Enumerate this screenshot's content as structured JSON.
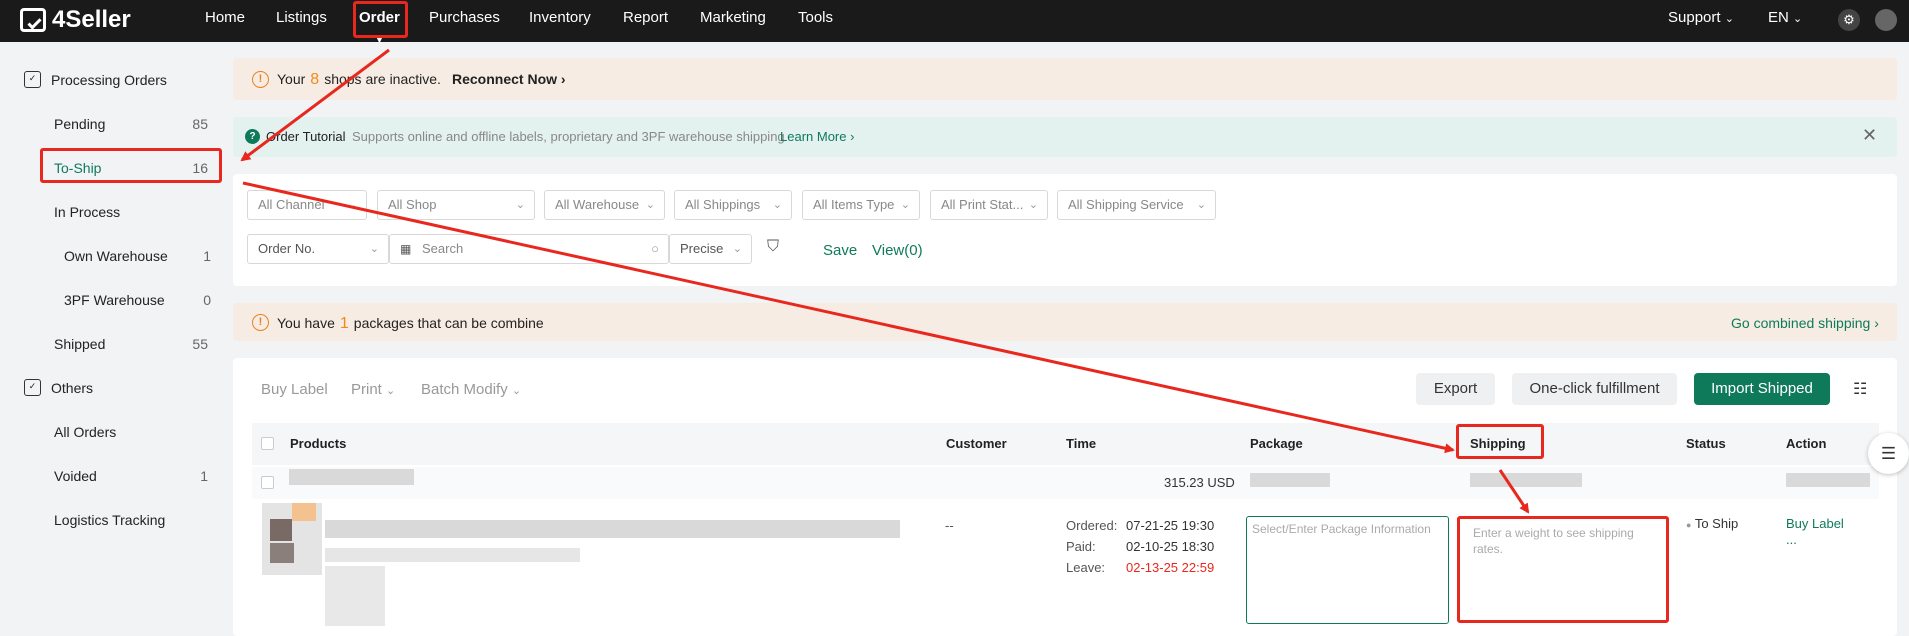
{
  "brand": "4Seller",
  "nav": {
    "items": [
      "Home",
      "Listings",
      "Order",
      "Purchases",
      "Inventory",
      "Report",
      "Marketing",
      "Tools"
    ],
    "right": {
      "support": "Support",
      "lang": "EN"
    }
  },
  "sidebar": {
    "processing_title": "Processing Orders",
    "items": [
      {
        "label": "Pending",
        "count": "85"
      },
      {
        "label": "To-Ship",
        "count": "16"
      },
      {
        "label": "In Process",
        "count": ""
      },
      {
        "label": "Own Warehouse",
        "count": "1"
      },
      {
        "label": "3PF Warehouse",
        "count": "0"
      },
      {
        "label": "Shipped",
        "count": "55"
      }
    ],
    "others_title": "Others",
    "others": [
      {
        "label": "All Orders",
        "count": ""
      },
      {
        "label": "Voided",
        "count": "1"
      },
      {
        "label": "Logistics Tracking",
        "count": ""
      }
    ]
  },
  "inactive_notice": {
    "prefix": "Your",
    "count": "8",
    "suffix": "shops are inactive.",
    "action": "Reconnect Now"
  },
  "tutorial": {
    "title": "Order Tutorial",
    "text": "Supports online and offline labels, proprietary and 3PF warehouse shipping",
    "link": "Learn More"
  },
  "filters": {
    "row1": [
      "All Channel",
      "All Shop",
      "All Warehouse",
      "All Shippings",
      "All Items Type",
      "All Print Stat...",
      "All Shipping Service"
    ],
    "order_no": "Order No.",
    "search_placeholder": "Search",
    "match": "Precise",
    "save": "Save",
    "view": "View(0)"
  },
  "combine_notice": {
    "prefix": "You have",
    "count": "1",
    "suffix": "packages that can be combine",
    "action": "Go combined shipping"
  },
  "toolbar": {
    "buy_label": "Buy Label",
    "print": "Print",
    "batch_modify": "Batch Modify",
    "export": "Export",
    "one_click": "One-click fulfillment",
    "import_shipped": "Import Shipped"
  },
  "table": {
    "headers": [
      "Products",
      "Customer",
      "Time",
      "Package",
      "Shipping",
      "Status",
      "Action"
    ],
    "group_amount": "315.23 USD",
    "order": {
      "customer": "--",
      "ordered_label": "Ordered:",
      "ordered": "07-21-25 19:30",
      "paid_label": "Paid:",
      "paid": "02-10-25 18:30",
      "leave_label": "Leave:",
      "leave": "02-13-25 22:59",
      "package_placeholder": "Select/Enter Package Information",
      "shipping_placeholder": "Enter a weight to see shipping rates.",
      "status": "To Ship",
      "action": "Buy Label",
      "more": "..."
    }
  },
  "colors": {
    "accent": "#0f7a5a",
    "annotation": "#e8271e",
    "warning": "#f08a1c"
  }
}
